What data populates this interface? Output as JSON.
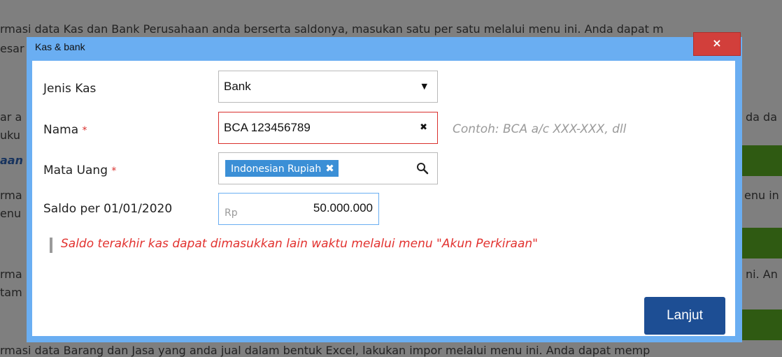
{
  "background": {
    "line1": "rmasi data Kas dan Bank Perusahaan anda berserta saldonya, masukan satu per satu melalui menu ini. Anda dapat m",
    "line2": "esar",
    "line3": "ar a",
    "line3r": "da da",
    "line4": "uku",
    "line5": "aan",
    "line6": "rma",
    "line6r": "enu in",
    "line7": "enu",
    "line8": "rma",
    "line8r": "ni. An",
    "line9": "tam",
    "line10": "rmasi data Barang dan Jasa yang anda jual dalam bentuk Excel, lakukan impor melalui menu ini. Anda dapat memp"
  },
  "dialog": {
    "title": "Kas & bank",
    "close_label": "×",
    "fields": {
      "jenis_kas": {
        "label": "Jenis Kas",
        "value": "Bank",
        "arrow": "▼"
      },
      "nama": {
        "label": "Nama",
        "required": "*",
        "value": "BCA 123456789",
        "clear": "✖",
        "hint": "Contoh: BCA a/c XXX-XXX, dll"
      },
      "mata_uang": {
        "label": "Mata Uang",
        "required": "*",
        "chip": "Indonesian Rupiah",
        "chip_remove": "✖"
      },
      "saldo": {
        "label": "Saldo per 01/01/2020",
        "prefix": "Rp",
        "value": "50.000.000"
      }
    },
    "note": "Saldo terakhir kas dapat dimasukkan lain waktu melalui menu \"Akun Perkiraan\"",
    "submit_label": "Lanjut"
  },
  "colors": {
    "title_bar": "#6aaef2",
    "close": "#d23f3b",
    "error_border": "#d9302d",
    "focus_border": "#6aaef2",
    "chip": "#3b8fd6",
    "button": "#1d4e94",
    "note": "#e2322f"
  }
}
